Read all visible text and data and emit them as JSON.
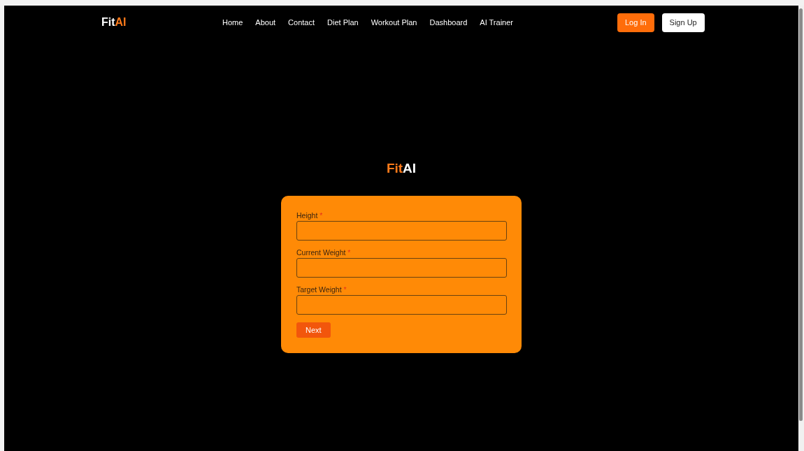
{
  "nav": {
    "logo": {
      "part_1": "Fit",
      "part_2": "AI"
    },
    "links": [
      {
        "label": "Home"
      },
      {
        "label": "About"
      },
      {
        "label": "Contact"
      },
      {
        "label": "Diet Plan"
      },
      {
        "label": "Workout Plan"
      },
      {
        "label": "Dashboard"
      },
      {
        "label": "AI Trainer"
      }
    ],
    "buttons": [
      {
        "label": "Log In",
        "kind": "primary"
      },
      {
        "label": "Sign Up",
        "kind": "secondary"
      }
    ]
  },
  "form": {
    "title": {
      "part_1": "Fit",
      "part_2": "AI"
    },
    "fields": [
      {
        "label": "Height",
        "mark": "*"
      },
      {
        "label": "Current Weight",
        "mark": "*"
      },
      {
        "label": "Target Weight",
        "mark": "*"
      }
    ],
    "submit": "Next"
  }
}
